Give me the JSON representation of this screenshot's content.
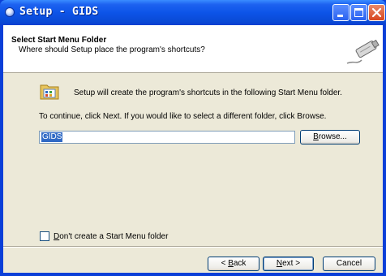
{
  "window": {
    "title": "Setup - GIDS",
    "buttons": {
      "minimize": "minimize-icon",
      "maximize": "maximize-icon",
      "close": "close-icon"
    }
  },
  "header": {
    "title": "Select Start Menu Folder",
    "subtitle": "Where should Setup place the program's shortcuts?",
    "image_icon": "wizard-cable-icon"
  },
  "body": {
    "folder_icon": "program-folder-icon",
    "info_text": "Setup will create the program's shortcuts in the following Start Menu folder.",
    "instruction_text": "To continue, click Next. If you would like to select a different folder, click Browse.",
    "folder_value": "GIDS",
    "browse": {
      "prefix": "",
      "mnemonic": "B",
      "rest": "rowse..."
    },
    "no_folder_checkbox": {
      "checked": false,
      "prefix": "",
      "mnemonic": "D",
      "rest": "on't create a Start Menu folder"
    }
  },
  "footer": {
    "back": {
      "prefix": "< ",
      "mnemonic": "B",
      "rest": "ack"
    },
    "next": {
      "prefix": "",
      "mnemonic": "N",
      "rest": "ext >"
    },
    "cancel": {
      "label": "Cancel"
    }
  },
  "colors": {
    "title_bar": "#0a4ad6",
    "selection": "#316ac5",
    "dialog_bg": "#ece9d8"
  }
}
